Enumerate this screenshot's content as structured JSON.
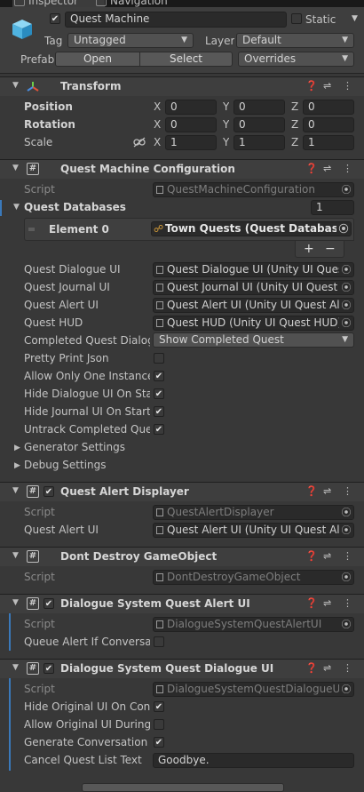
{
  "tabs": [
    {
      "label": "Inspector"
    },
    {
      "label": "Navigation"
    }
  ],
  "gameobject": {
    "active": true,
    "name": "Quest Machine",
    "static_label": "Static",
    "tag_label": "Tag",
    "tag_value": "Untagged",
    "layer_label": "Layer",
    "layer_value": "Default",
    "prefab_label": "Prefab",
    "open_label": "Open",
    "select_label": "Select",
    "overrides_label": "Overrides"
  },
  "transform": {
    "title": "Transform",
    "rows": [
      {
        "label": "Position",
        "x": "0",
        "y": "0",
        "z": "0"
      },
      {
        "label": "Rotation",
        "x": "0",
        "y": "0",
        "z": "0"
      },
      {
        "label": "Scale",
        "x": "1",
        "y": "1",
        "z": "1"
      }
    ],
    "axis": {
      "x": "X",
      "y": "Y",
      "z": "Z"
    }
  },
  "qmc": {
    "title": "Quest Machine Configuration",
    "script_label": "Script",
    "script_value": "QuestMachineConfiguration",
    "databases_label": "Quest Databases",
    "databases_count": "1",
    "element_label": "Element 0",
    "element_value": "Town Quests (Quest Database)",
    "plus": "+",
    "minus": "−",
    "fields": [
      {
        "label": "Quest Dialogue UI",
        "value": "Quest Dialogue UI (Unity UI Quest"
      },
      {
        "label": "Quest Journal UI",
        "value": "Quest Journal UI (Unity UI Quest J"
      },
      {
        "label": "Quest Alert UI",
        "value": "Quest Alert UI (Unity UI Quest Alert"
      },
      {
        "label": "Quest HUD",
        "value": "Quest HUD (Unity UI Quest HUD)"
      }
    ],
    "completed_label": "Completed Quest Dialogu",
    "completed_value": "Show Completed Quest",
    "toggles": [
      {
        "label": "Pretty Print Json",
        "checked": false
      },
      {
        "label": "Allow Only One Instance",
        "checked": true
      },
      {
        "label": "Hide Dialogue UI On Start",
        "checked": true
      },
      {
        "label": "Hide Journal UI On Start",
        "checked": true
      },
      {
        "label": "Untrack Completed Quest",
        "checked": true
      }
    ],
    "generator_label": "Generator Settings",
    "debug_label": "Debug Settings"
  },
  "qad": {
    "title": "Quest Alert Displayer",
    "enabled": true,
    "script_label": "Script",
    "script_value": "QuestAlertDisplayer",
    "alert_label": "Quest Alert UI",
    "alert_value": "Quest Alert UI (Unity UI Quest Alert"
  },
  "ddg": {
    "title": "Dont Destroy GameObject",
    "script_label": "Script",
    "script_value": "DontDestroyGameObject"
  },
  "dsqa": {
    "title": "Dialogue System Quest Alert UI",
    "enabled": true,
    "script_label": "Script",
    "script_value": "DialogueSystemQuestAlertUI",
    "queue_label": "Queue Alert If Conversatio",
    "queue_checked": false
  },
  "dsqd": {
    "title": "Dialogue System Quest Dialogue UI",
    "enabled": true,
    "script_label": "Script",
    "script_value": "DialogueSystemQuestDialogueUI",
    "toggles": [
      {
        "label": "Hide Original UI On Conve",
        "checked": true
      },
      {
        "label": "Allow Original UI During C",
        "checked": false
      },
      {
        "label": "Generate Conversation Fo",
        "checked": true
      }
    ],
    "cancel_label": "Cancel Quest List Text",
    "cancel_value": "Goodbye."
  },
  "icons": {
    "help": "help-icon",
    "presets": "presets-icon",
    "menu": "menu-icon",
    "picker": "object-picker-icon"
  },
  "colors": {
    "background": "#383838",
    "header": "#3e3e3e",
    "field": "#2a2a2a",
    "accent": "#3a79bb"
  }
}
